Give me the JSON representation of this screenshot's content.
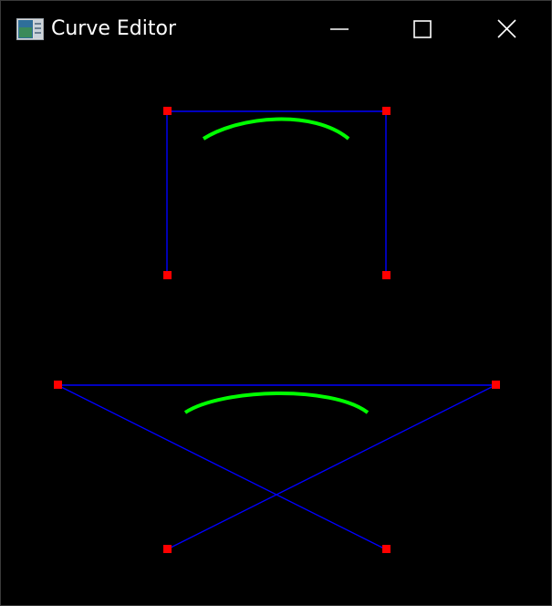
{
  "window": {
    "title": "Curve Editor",
    "icon": "app-window-icon",
    "controls": {
      "minimize_icon": "minimize-icon",
      "maximize_icon": "maximize-icon",
      "close_icon": "close-icon"
    }
  },
  "colors": {
    "background": "#000000",
    "control_line": "#0000ff",
    "control_point": "#ff0000",
    "curve": "#00ff00",
    "title_text": "#ffffff"
  }
}
